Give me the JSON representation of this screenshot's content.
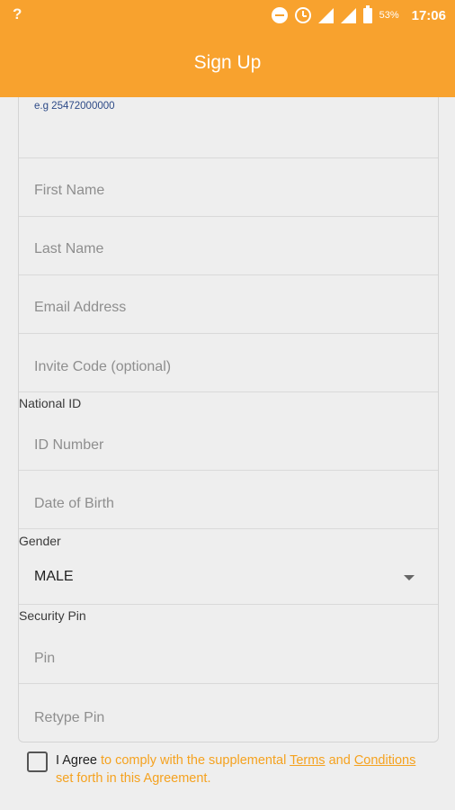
{
  "status_bar": {
    "network_icon": "network-question-icon",
    "network_symbol": "?",
    "icons": [
      "do-not-disturb-icon",
      "alarm-icon",
      "signal-r-icon",
      "signal-4g-icon",
      "battery-icon"
    ],
    "signal1_label": "R",
    "signal2_label": "4G",
    "battery_percent": "53%",
    "time": "17:06"
  },
  "app_bar": {
    "title": "Sign Up",
    "color": "#f8a22e"
  },
  "form": {
    "phone_hint": "e.g 25472000000",
    "first_name_placeholder": "First Name",
    "last_name_placeholder": "Last Name",
    "email_placeholder": "Email Address",
    "invite_code_placeholder": "Invite Code (optional)",
    "national_id_label": "National ID",
    "id_number_placeholder": "ID Number",
    "dob_placeholder": "Date of Birth",
    "gender_label": "Gender",
    "gender_value": "MALE",
    "security_pin_label": "Security Pin",
    "pin_placeholder": "Pin",
    "retype_pin_placeholder": "Retype Pin"
  },
  "agreement": {
    "checked": false,
    "bold_text": "I Agree",
    "text_before": " to comply with the supplemental ",
    "terms_link": "Terms",
    "text_and": " and ",
    "conditions_link": "Conditions",
    "text_after": " set forth in this Agreement.",
    "accent_color": "#f5a21f"
  }
}
